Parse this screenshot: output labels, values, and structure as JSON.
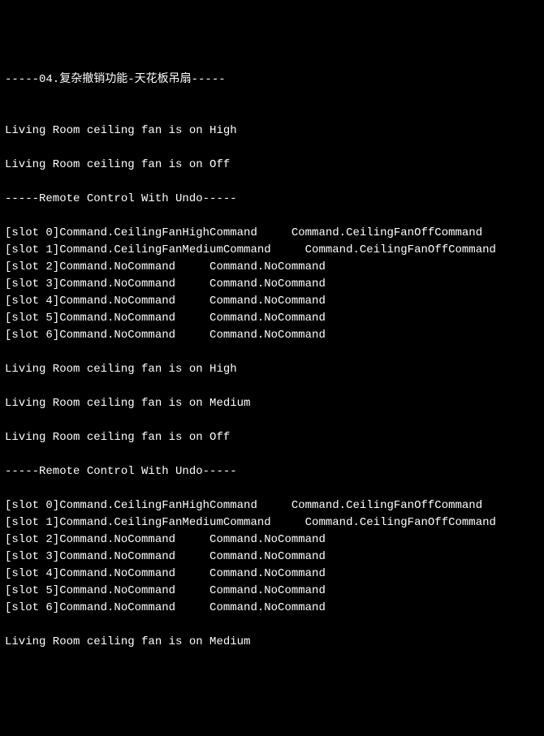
{
  "lines": [
    "-----04.复杂撤销功能-天花板吊扇-----",
    "",
    "",
    "Living Room ceiling fan is on High",
    "",
    "Living Room ceiling fan is on Off",
    "",
    "-----Remote Control With Undo-----",
    "",
    "[slot 0]Command.CeilingFanHighCommand     Command.CeilingFanOffCommand",
    "[slot 1]Command.CeilingFanMediumCommand     Command.CeilingFanOffCommand",
    "[slot 2]Command.NoCommand     Command.NoCommand",
    "[slot 3]Command.NoCommand     Command.NoCommand",
    "[slot 4]Command.NoCommand     Command.NoCommand",
    "[slot 5]Command.NoCommand     Command.NoCommand",
    "[slot 6]Command.NoCommand     Command.NoCommand",
    "",
    "Living Room ceiling fan is on High",
    "",
    "Living Room ceiling fan is on Medium",
    "",
    "Living Room ceiling fan is on Off",
    "",
    "-----Remote Control With Undo-----",
    "",
    "[slot 0]Command.CeilingFanHighCommand     Command.CeilingFanOffCommand",
    "[slot 1]Command.CeilingFanMediumCommand     Command.CeilingFanOffCommand",
    "[slot 2]Command.NoCommand     Command.NoCommand",
    "[slot 3]Command.NoCommand     Command.NoCommand",
    "[slot 4]Command.NoCommand     Command.NoCommand",
    "[slot 5]Command.NoCommand     Command.NoCommand",
    "[slot 6]Command.NoCommand     Command.NoCommand",
    "",
    "Living Room ceiling fan is on Medium"
  ]
}
